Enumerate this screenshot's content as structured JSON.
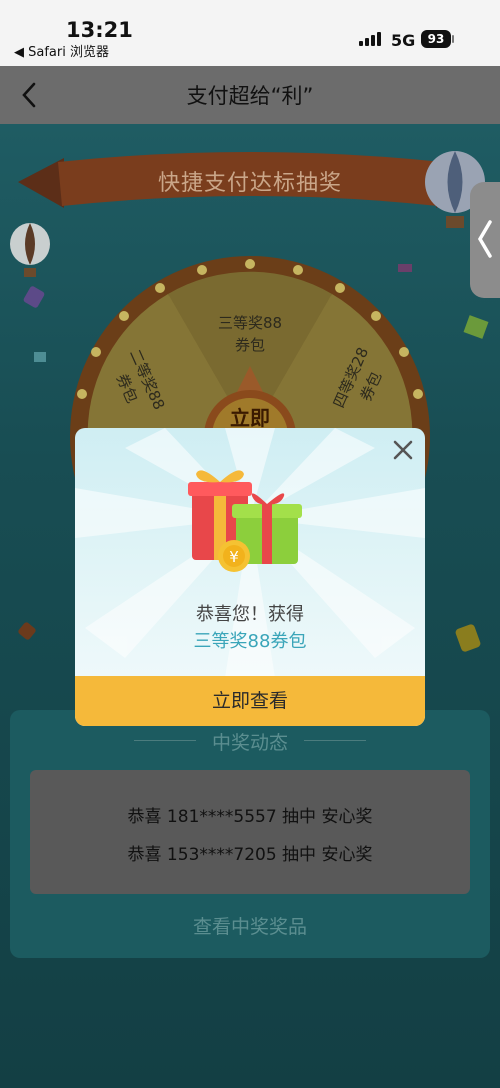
{
  "status": {
    "time": "13:21",
    "back_app": "◀ Safari 浏览器",
    "network": "5G",
    "battery": "93"
  },
  "nav": {
    "title": "支付超给“利”"
  },
  "banner": {
    "title": "快捷支付达标抽奖"
  },
  "wheel": {
    "prize_3": "三等奖88\n券包",
    "prize_2": "二等奖88\n券包",
    "prize_4": "四等奖28\n券包",
    "center": "立即"
  },
  "winners": {
    "title": "中奖动态",
    "rows": [
      {
        "text": "恭喜 181****5557 抽中 安心奖"
      },
      {
        "text": "恭喜 153****7205 抽中 安心奖"
      }
    ],
    "link": "查看中奖奖品"
  },
  "modal": {
    "congrats": "恭喜您！获得",
    "prize": "三等奖88券包",
    "cta": "立即查看"
  },
  "colors": {
    "accent": "#3aa5b9",
    "cta": "#f5b93a"
  }
}
